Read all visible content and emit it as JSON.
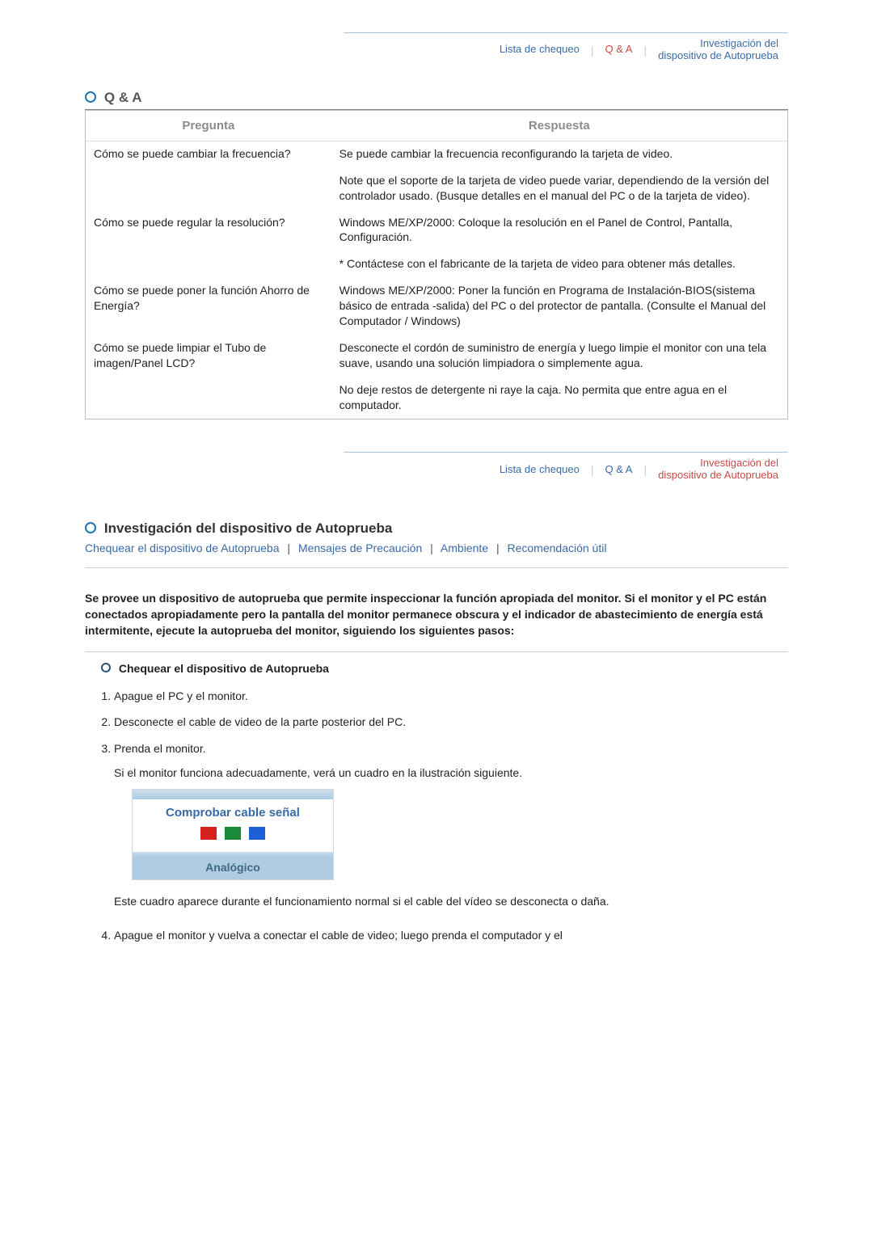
{
  "topnav": {
    "lista": "Lista de chequeo",
    "qa": "Q & A",
    "investigacion_l1": "Investigación del",
    "investigacion_l2": "dispositivo de Autoprueba"
  },
  "section1": {
    "title": "Q & A"
  },
  "qa": {
    "h_pregunta": "Pregunta",
    "h_respuesta": "Respuesta",
    "r1_q": "Cómo se puede cambiar la frecuencia?",
    "r1_a1": "Se puede cambiar la frecuencia reconfigurando la tarjeta de video.",
    "r1_a2": "Note que el soporte de la tarjeta de video puede variar, dependiendo de la versión del controlador usado. (Busque detalles en el manual del PC o de la tarjeta de video).",
    "r2_q": "Cómo se puede regular la resolución?",
    "r2_a1": "Windows ME/XP/2000: Coloque la resolución en el Panel de Control, Pantalla, Configuración.",
    "r2_a2": "* Contáctese con el fabricante de la tarjeta de video para obtener más detalles.",
    "r3_q": "Cómo se puede poner la función Ahorro de Energía?",
    "r3_a": "Windows ME/XP/2000: Poner la función en Programa de Instalación-BIOS(sistema básico de entrada -salida) del PC o del protector de pantalla. (Consulte el Manual del Computador / Windows)",
    "r4_q": "Cómo se puede limpiar el Tubo de imagen/Panel LCD?",
    "r4_a1": "Desconecte el cordón de suministro de energía y luego limpie el monitor con una tela suave, usando una solución limpiadora o simplemente agua.",
    "r4_a2": "No deje restos de detergente ni raye la caja. No permita que entre agua en el computador."
  },
  "section2": {
    "title": "Investigación del dispositivo de Autoprueba",
    "links": {
      "l1": "Chequear el dispositivo de Autoprueba",
      "l2": "Mensajes de Precaución",
      "l3": "Ambiente",
      "l4": "Recomendación útil"
    },
    "intro": "Se provee un dispositivo de autoprueba que permite inspeccionar la función apropiada del monitor. Si el monitor y el PC están conectados apropiadamente pero la pantalla del monitor permanece obscura y el indicador de abastecimiento de energía está intermitente, ejecute la autoprueba del monitor, siguiendo los siguientes pasos:",
    "subhead": "Chequear el dispositivo de Autoprueba",
    "steps": {
      "s1": "Apague el PC y el monitor.",
      "s2": "Desconecte el cable de video de la parte posterior del PC.",
      "s3": "Prenda el monitor.",
      "s3_p1": "Si el monitor funciona adecuadamente, verá un cuadro en la ilustración siguiente.",
      "s3_box_title": "Comprobar cable señal",
      "s3_box_footer": "Analógico",
      "s3_p2": "Este cuadro aparece durante el funcionamiento normal si el cable del vídeo se desconecta o daña.",
      "s4": "Apague el monitor y vuelva a conectar el cable de video; luego prenda el computador y el"
    }
  }
}
